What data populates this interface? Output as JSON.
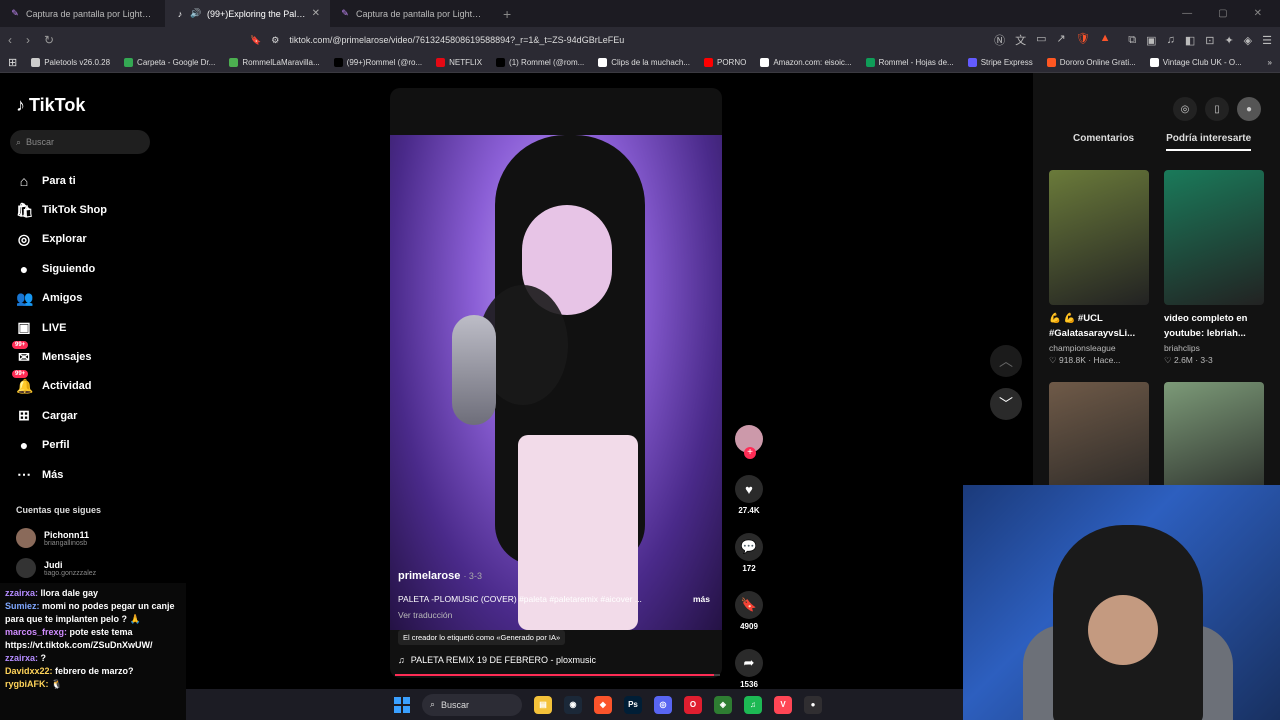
{
  "browser": {
    "tabs": [
      {
        "title": "Captura de pantalla por Lightshot",
        "active": false
      },
      {
        "title": "(99+)Exploring the Paleta Re…",
        "active": true
      },
      {
        "title": "Captura de pantalla por Lightshot",
        "active": false
      }
    ],
    "url": "tiktok.com/@primelarose/video/7613245808619588894?_r=1&_t=ZS-94dGBrLeFEu",
    "bookmarks": [
      {
        "label": "Paletools v26.0.28",
        "color": "#ccc"
      },
      {
        "label": "Carpeta - Google Dr...",
        "color": "#34a853"
      },
      {
        "label": "RommelLaMaravilla...",
        "color": "#4caf50"
      },
      {
        "label": "(99+)Rommel (@ro...",
        "color": "#000"
      },
      {
        "label": "NETFLIX",
        "color": "#e50914"
      },
      {
        "label": "(1) Rommel (@rom...",
        "color": "#000"
      },
      {
        "label": "Clips de la muchach...",
        "color": "#fff"
      },
      {
        "label": "PORNO",
        "color": "#f00"
      },
      {
        "label": "Amazon.com: eisoic...",
        "color": "#fff"
      },
      {
        "label": "Rommel - Hojas de...",
        "color": "#0f9d58"
      },
      {
        "label": "Stripe Express",
        "color": "#635bff"
      },
      {
        "label": "Dororo Online Grati...",
        "color": "#ff5722"
      },
      {
        "label": "Vintage Club UK - O...",
        "color": "#fff"
      }
    ]
  },
  "sidebar": {
    "logo": "TikTok",
    "search_placeholder": "Buscar",
    "nav": [
      {
        "label": "Para ti",
        "icon": "home-icon",
        "glyph": "⌂"
      },
      {
        "label": "TikTok Shop",
        "icon": "shop-icon",
        "glyph": "🛍"
      },
      {
        "label": "Explorar",
        "icon": "compass-icon",
        "glyph": "◎"
      },
      {
        "label": "Siguiendo",
        "icon": "following-avatar-icon",
        "glyph": "●"
      },
      {
        "label": "Amigos",
        "icon": "friends-icon",
        "glyph": "👥"
      },
      {
        "label": "LIVE",
        "icon": "live-icon",
        "glyph": "▣"
      },
      {
        "label": "Mensajes",
        "icon": "messages-icon",
        "glyph": "✉",
        "badge": "99+"
      },
      {
        "label": "Actividad",
        "icon": "activity-icon",
        "glyph": "🔔",
        "badge": "99+"
      },
      {
        "label": "Cargar",
        "icon": "upload-icon",
        "glyph": "⊞"
      },
      {
        "label": "Perfil",
        "icon": "profile-icon",
        "glyph": "●"
      },
      {
        "label": "Más",
        "icon": "more-icon",
        "glyph": "⋯"
      }
    ],
    "following_title": "Cuentas que sigues",
    "following": [
      {
        "name": "Pichonn11",
        "handle": "briangallinosb"
      },
      {
        "name": "Judi",
        "handle": "tiago.gonzzzalez"
      }
    ]
  },
  "video": {
    "username": "primelarose",
    "date": "· 3-3",
    "caption": "PALETA -PLOMUSIC (COVER) #paleta #paletaremix #aicover ...",
    "more": "más",
    "translate": "Ver traducción",
    "ai_label": "El creador lo etiquetó como «Generado por IA»",
    "music": "PALETA REMIX 19 DE FEBRERO - ploxmusic",
    "progress": 0.98
  },
  "actions": {
    "likes": "27.4K",
    "comments": "172",
    "saves": "4909",
    "shares": "1536"
  },
  "right_panel": {
    "tabs": [
      "Comentarios",
      "Podría interesarte"
    ],
    "active_tab": 1,
    "cards": [
      {
        "title": "💪 💪 #UCL #GalatasarayvsLi...",
        "channel": "championsleague",
        "stats": "♡ 918.8K · Hace...",
        "color": "#6a7a3a"
      },
      {
        "title": "video completo en youtube: lebriah...",
        "channel": "briahclips",
        "stats": "♡ 2.6M · 3-3",
        "color": "#1a7a5a"
      },
      {
        "title": "",
        "channel": "",
        "stats": "",
        "color": "#6f5a48"
      },
      {
        "title": "",
        "channel": "",
        "stats": "",
        "color": "#7c9a78"
      }
    ]
  },
  "chat": [
    {
      "user": "zzairxa:",
      "msg": " llora dale gay",
      "cls": "u"
    },
    {
      "user": "Sumiez:",
      "msg": " momi no podes pegar un canje para que te implanten pelo ? 🙏",
      "cls": "u2"
    },
    {
      "user": "marcos_frexg:",
      "msg": " pote este tema https://vt.tiktok.com/ZSuDnXwUW/",
      "cls": "u3"
    },
    {
      "user": "zzairxa:",
      "msg": " ?",
      "cls": "u"
    },
    {
      "user": "Davidxx22:",
      "msg": " febrero de marzo?",
      "cls": "u4"
    },
    {
      "user": "rygbiAFK:",
      "msg": " 🐧",
      "cls": "u4"
    }
  ],
  "taskbar": {
    "search": "Buscar",
    "apps": [
      {
        "name": "file-explorer-icon",
        "color": "#f4c23a",
        "glyph": "▤"
      },
      {
        "name": "steam-icon",
        "color": "#1b2838",
        "glyph": "◉"
      },
      {
        "name": "brave-icon",
        "color": "#fb542b",
        "glyph": "◆"
      },
      {
        "name": "photoshop-icon",
        "color": "#001e36",
        "glyph": "Ps"
      },
      {
        "name": "discord-icon",
        "color": "#5865f2",
        "glyph": "◎"
      },
      {
        "name": "opera-icon",
        "color": "#e01e2f",
        "glyph": "O"
      },
      {
        "name": "app-icon",
        "color": "#2e7d32",
        "glyph": "◈"
      },
      {
        "name": "spotify-icon",
        "color": "#1db954",
        "glyph": "♫"
      },
      {
        "name": "valorant-icon",
        "color": "#ff4655",
        "glyph": "V"
      },
      {
        "name": "obs-icon",
        "color": "#302e31",
        "glyph": "●"
      }
    ]
  }
}
